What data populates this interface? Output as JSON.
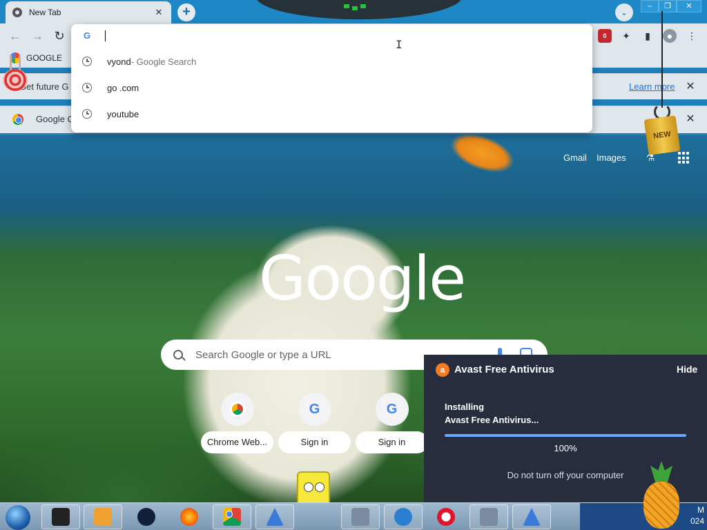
{
  "browser": {
    "tab_title": "New Tab",
    "tab_close": "✕",
    "new_tab_label": "+",
    "tab_search_label": "⌄",
    "window_controls": [
      "–",
      "❐",
      "✕"
    ]
  },
  "toolbar": {
    "back": "←",
    "forward": "→",
    "reload": "↻",
    "ext_badge": "0",
    "menu": "⋮"
  },
  "bookmarks": [
    {
      "label": "GOOGLE"
    }
  ],
  "infobars": [
    {
      "text": "Get future G",
      "link": "Learn more",
      "close": "✕"
    },
    {
      "text": "Google C",
      "close": "✕"
    }
  ],
  "omnibox": {
    "input_value": "",
    "g_label": "G",
    "suggestions": [
      {
        "text": "vyond",
        "sub": " - Google Search"
      },
      {
        "text": "go .com",
        "sub": ""
      },
      {
        "text": "youtube",
        "sub": ""
      }
    ]
  },
  "ntp": {
    "gmail": "Gmail",
    "images": "Images",
    "logo": "Google",
    "search_placeholder": "Search Google or type a URL",
    "shortcuts": [
      {
        "label": "Chrome Web...",
        "icon": "chrome-web-store-icon"
      },
      {
        "label": "Sign in",
        "icon": "google-g-icon"
      },
      {
        "label": "Sign in",
        "icon": "google-g-icon"
      }
    ]
  },
  "avast": {
    "title": "Avast Free Antivirus",
    "hide": "Hide",
    "status_line1": "Installing",
    "status_line2": "Avast Free Antivirus...",
    "progress": 1.0,
    "progress_label": "100%",
    "note": "Do not turn off your computer"
  },
  "pets": {
    "can_label": "NEW"
  },
  "taskbar": {
    "apps": [
      "terminal-icon",
      "media-player-icon",
      "globe-icon",
      "firefox-icon",
      "chrome-icon",
      "shark-icon",
      "network-computer-icon",
      "messenger-icon",
      "opera-icon",
      "network-computer-icon",
      "shark-icon"
    ],
    "clock_line1": "M",
    "clock_line2": "024"
  }
}
